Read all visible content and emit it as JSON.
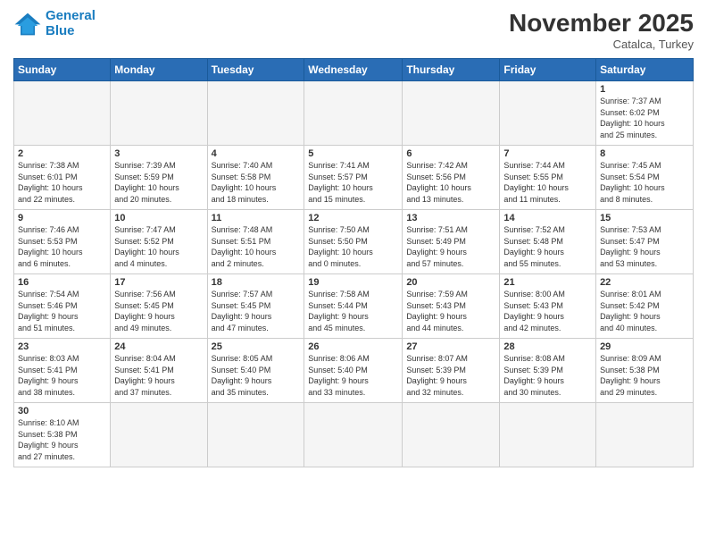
{
  "header": {
    "logo_line1": "General",
    "logo_line2": "Blue",
    "month": "November 2025",
    "location": "Catalca, Turkey"
  },
  "weekdays": [
    "Sunday",
    "Monday",
    "Tuesday",
    "Wednesday",
    "Thursday",
    "Friday",
    "Saturday"
  ],
  "days": [
    {
      "num": "",
      "info": "",
      "empty": true
    },
    {
      "num": "",
      "info": "",
      "empty": true
    },
    {
      "num": "",
      "info": "",
      "empty": true
    },
    {
      "num": "",
      "info": "",
      "empty": true
    },
    {
      "num": "",
      "info": "",
      "empty": true
    },
    {
      "num": "",
      "info": "",
      "empty": true
    },
    {
      "num": "1",
      "info": "Sunrise: 7:37 AM\nSunset: 6:02 PM\nDaylight: 10 hours\nand 25 minutes."
    },
    {
      "num": "2",
      "info": "Sunrise: 7:38 AM\nSunset: 6:01 PM\nDaylight: 10 hours\nand 22 minutes."
    },
    {
      "num": "3",
      "info": "Sunrise: 7:39 AM\nSunset: 5:59 PM\nDaylight: 10 hours\nand 20 minutes."
    },
    {
      "num": "4",
      "info": "Sunrise: 7:40 AM\nSunset: 5:58 PM\nDaylight: 10 hours\nand 18 minutes."
    },
    {
      "num": "5",
      "info": "Sunrise: 7:41 AM\nSunset: 5:57 PM\nDaylight: 10 hours\nand 15 minutes."
    },
    {
      "num": "6",
      "info": "Sunrise: 7:42 AM\nSunset: 5:56 PM\nDaylight: 10 hours\nand 13 minutes."
    },
    {
      "num": "7",
      "info": "Sunrise: 7:44 AM\nSunset: 5:55 PM\nDaylight: 10 hours\nand 11 minutes."
    },
    {
      "num": "8",
      "info": "Sunrise: 7:45 AM\nSunset: 5:54 PM\nDaylight: 10 hours\nand 8 minutes."
    },
    {
      "num": "9",
      "info": "Sunrise: 7:46 AM\nSunset: 5:53 PM\nDaylight: 10 hours\nand 6 minutes."
    },
    {
      "num": "10",
      "info": "Sunrise: 7:47 AM\nSunset: 5:52 PM\nDaylight: 10 hours\nand 4 minutes."
    },
    {
      "num": "11",
      "info": "Sunrise: 7:48 AM\nSunset: 5:51 PM\nDaylight: 10 hours\nand 2 minutes."
    },
    {
      "num": "12",
      "info": "Sunrise: 7:50 AM\nSunset: 5:50 PM\nDaylight: 10 hours\nand 0 minutes."
    },
    {
      "num": "13",
      "info": "Sunrise: 7:51 AM\nSunset: 5:49 PM\nDaylight: 9 hours\nand 57 minutes."
    },
    {
      "num": "14",
      "info": "Sunrise: 7:52 AM\nSunset: 5:48 PM\nDaylight: 9 hours\nand 55 minutes."
    },
    {
      "num": "15",
      "info": "Sunrise: 7:53 AM\nSunset: 5:47 PM\nDaylight: 9 hours\nand 53 minutes."
    },
    {
      "num": "16",
      "info": "Sunrise: 7:54 AM\nSunset: 5:46 PM\nDaylight: 9 hours\nand 51 minutes."
    },
    {
      "num": "17",
      "info": "Sunrise: 7:56 AM\nSunset: 5:45 PM\nDaylight: 9 hours\nand 49 minutes."
    },
    {
      "num": "18",
      "info": "Sunrise: 7:57 AM\nSunset: 5:45 PM\nDaylight: 9 hours\nand 47 minutes."
    },
    {
      "num": "19",
      "info": "Sunrise: 7:58 AM\nSunset: 5:44 PM\nDaylight: 9 hours\nand 45 minutes."
    },
    {
      "num": "20",
      "info": "Sunrise: 7:59 AM\nSunset: 5:43 PM\nDaylight: 9 hours\nand 44 minutes."
    },
    {
      "num": "21",
      "info": "Sunrise: 8:00 AM\nSunset: 5:43 PM\nDaylight: 9 hours\nand 42 minutes."
    },
    {
      "num": "22",
      "info": "Sunrise: 8:01 AM\nSunset: 5:42 PM\nDaylight: 9 hours\nand 40 minutes."
    },
    {
      "num": "23",
      "info": "Sunrise: 8:03 AM\nSunset: 5:41 PM\nDaylight: 9 hours\nand 38 minutes."
    },
    {
      "num": "24",
      "info": "Sunrise: 8:04 AM\nSunset: 5:41 PM\nDaylight: 9 hours\nand 37 minutes."
    },
    {
      "num": "25",
      "info": "Sunrise: 8:05 AM\nSunset: 5:40 PM\nDaylight: 9 hours\nand 35 minutes."
    },
    {
      "num": "26",
      "info": "Sunrise: 8:06 AM\nSunset: 5:40 PM\nDaylight: 9 hours\nand 33 minutes."
    },
    {
      "num": "27",
      "info": "Sunrise: 8:07 AM\nSunset: 5:39 PM\nDaylight: 9 hours\nand 32 minutes."
    },
    {
      "num": "28",
      "info": "Sunrise: 8:08 AM\nSunset: 5:39 PM\nDaylight: 9 hours\nand 30 minutes."
    },
    {
      "num": "29",
      "info": "Sunrise: 8:09 AM\nSunset: 5:38 PM\nDaylight: 9 hours\nand 29 minutes."
    },
    {
      "num": "30",
      "info": "Sunrise: 8:10 AM\nSunset: 5:38 PM\nDaylight: 9 hours\nand 27 minutes.",
      "lastrow": true
    },
    {
      "num": "",
      "info": "",
      "empty": true,
      "lastrow": true
    },
    {
      "num": "",
      "info": "",
      "empty": true,
      "lastrow": true
    },
    {
      "num": "",
      "info": "",
      "empty": true,
      "lastrow": true
    },
    {
      "num": "",
      "info": "",
      "empty": true,
      "lastrow": true
    },
    {
      "num": "",
      "info": "",
      "empty": true,
      "lastrow": true
    },
    {
      "num": "",
      "info": "",
      "empty": true,
      "lastrow": true
    }
  ]
}
